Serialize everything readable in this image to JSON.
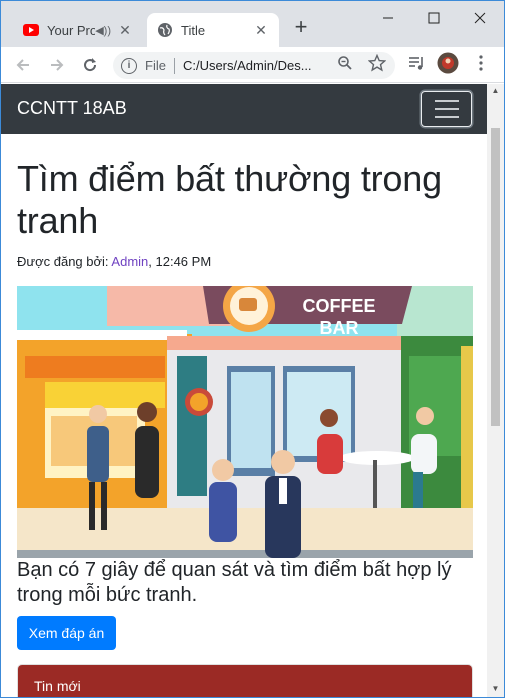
{
  "browser": {
    "tabs": [
      {
        "title": "Your Pro",
        "active": false,
        "favicon": "youtube-icon"
      },
      {
        "title": "Title",
        "active": true,
        "favicon": "globe-icon"
      }
    ],
    "omnibox": {
      "scheme_label": "File",
      "url": "C:/Users/Admin/Des..."
    }
  },
  "page": {
    "navbar": {
      "brand": "CCNTT 18AB"
    },
    "post": {
      "title": "Tìm điểm bất thường trong tranh",
      "meta_prefix": "Được đăng bởi: ",
      "author": "Admin",
      "time": ", 12:46 PM",
      "image_sign": {
        "line1": "COFFEE",
        "line2": "BAR"
      },
      "description": "Bạn có 7 giây để quan sát và tìm điểm bất hợp lý trong mỗi bức tranh.",
      "answer_button": "Xem đáp án"
    },
    "sidebar_card": {
      "header": "Tin mới"
    }
  },
  "colors": {
    "navbar": "#343a40",
    "primary": "#007bff",
    "link": "#6f42c1",
    "card_header": "#9b2a25"
  }
}
